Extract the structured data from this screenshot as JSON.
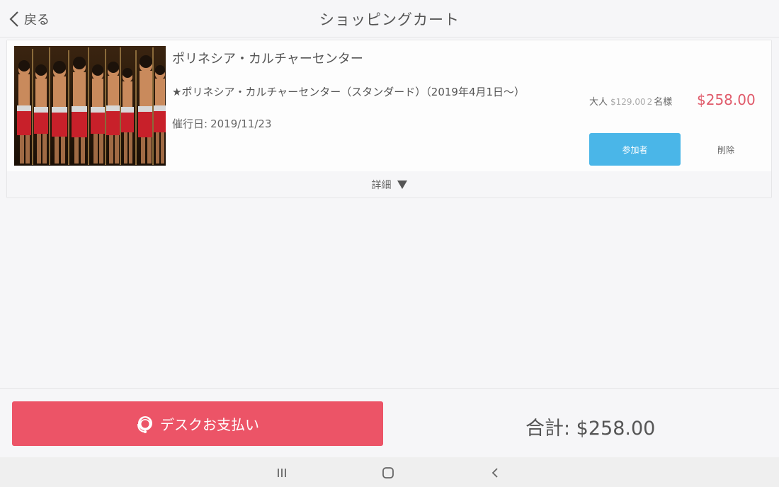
{
  "header": {
    "back_label": "戻る",
    "title": "ショッピングカート"
  },
  "cart_item": {
    "name": "ポリネシア・カルチャーセンター",
    "plan": "★ポリネシア・カルチャーセンター（スタンダード）（2019年4月1日〜）",
    "date_label": "催行日:",
    "date_value": "2019/11/23",
    "ticket_type": "大人",
    "unit_price": "$129.00",
    "quantity": "2",
    "quantity_unit": "名様",
    "line_total": "$258.00",
    "participants_label": "参加者",
    "delete_label": "削除",
    "details_label": "詳細"
  },
  "footer": {
    "pay_label": "デスクお支払い",
    "total": "合計: $258.00"
  },
  "colors": {
    "accent_blue": "#4ab6e8",
    "pay_red": "#ec5467",
    "price_red": "#e05a6a"
  }
}
